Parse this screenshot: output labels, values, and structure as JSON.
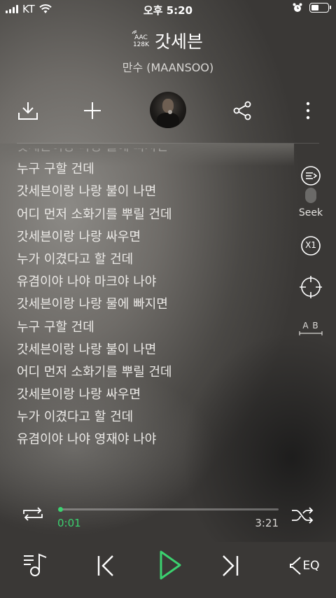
{
  "status_bar": {
    "carrier": "KT",
    "time": "오후 5:20",
    "battery_level": 0.45
  },
  "track": {
    "quality_line1": "AAC",
    "quality_line2": "128K",
    "title": "갓세븐",
    "artist": "만수 (MAANSOO)"
  },
  "actions": [
    "download-icon",
    "add-icon",
    "artist-avatar",
    "share-icon",
    "more-icon"
  ],
  "lyrics": [
    "갓세븐이랑 나랑 물에 빠지면",
    "누구 구할 건데",
    "갓세븐이랑 나랑 불이 나면",
    "어디 먼저 소화기를 뿌릴 건데",
    "갓세븐이랑 나랑 싸우면",
    "누가 이겼다고 할 건데",
    "유겸이야 나야 마크야 나야",
    "갓세븐이랑 나랑 물에 빠지면",
    "누구 구할 건데",
    "갓세븐이랑 나랑 불이 나면",
    "어디 먼저 소화기를 뿌릴 건데",
    "갓세븐이랑 나랑 싸우면",
    "누가 이겼다고 할 건데",
    "유겸이야 나야 영재야 나야"
  ],
  "side_controls": {
    "seek_label": "Seek",
    "speed_label": "X1",
    "ab_label": "A B"
  },
  "player": {
    "current_time": "0:01",
    "total_time": "3:21",
    "progress": 0.005,
    "eq_label": "EQ",
    "accent_color": "#3bd16f"
  }
}
